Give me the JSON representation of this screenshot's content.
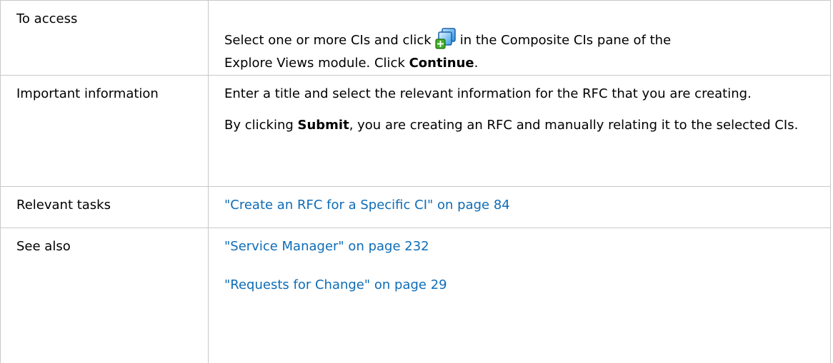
{
  "rows": [
    {
      "label": "To access",
      "line1_before_icon": "Select one or more CIs and click",
      "line1_after_icon": "in the Composite CIs pane of the",
      "line2_before_bold": "Explore Views module. Click ",
      "bold": "Continue",
      "line2_after_bold": ".",
      "icon": "add-composite-ci-icon"
    },
    {
      "label": "Important information",
      "para1": "Enter a title and select the relevant information for the RFC that you are creating.",
      "para2_prefix": "By clicking ",
      "para2_bold": "Submit",
      "para2_suffix": ", you are creating an RFC and manually relating it to the selected CIs."
    },
    {
      "label": "Relevant tasks",
      "links": [
        "\"Create an RFC for a Specific CI\" on page 84"
      ]
    },
    {
      "label": "See also",
      "links": [
        "\"Service Manager\" on page 232",
        "\"Requests for Change\" on page 29"
      ]
    }
  ],
  "colors": {
    "link": "#0e6cb7",
    "border": "#c8c8c8"
  }
}
